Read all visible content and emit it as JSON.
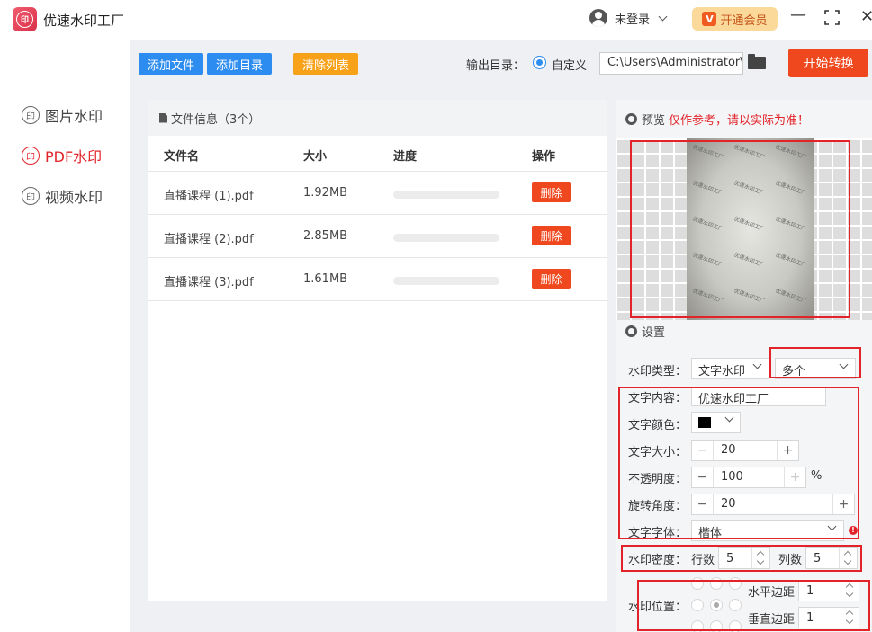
{
  "app": {
    "title": "优速水印工厂",
    "logo_glyph": "印"
  },
  "user": {
    "login_label": "未登录",
    "vip_label": "开通会员",
    "vip_glyph": "V"
  },
  "window": {
    "minimize": "—",
    "close": "✕"
  },
  "nav": {
    "items": [
      {
        "label": "图片水印",
        "glyph": "印",
        "active": false
      },
      {
        "label": "PDF水印",
        "glyph": "印",
        "active": true
      },
      {
        "label": "视频水印",
        "glyph": "印",
        "active": false
      }
    ]
  },
  "toolbar": {
    "add_file": "添加文件",
    "add_dir": "添加目录",
    "clear_list": "清除列表",
    "output_label": "输出目录：",
    "output_mode": "自定义",
    "output_path": "C:\\Users\\Administrator\\",
    "start": "开始转换"
  },
  "files": {
    "header": "文件信息（3个）",
    "columns": {
      "name": "文件名",
      "size": "大小",
      "progress": "进度",
      "action": "操作"
    },
    "rows": [
      {
        "name": "直播课程 (1).pdf",
        "size": "1.92MB",
        "progress": 0,
        "action": "删除"
      },
      {
        "name": "直播课程 (2).pdf",
        "size": "2.85MB",
        "progress": 0,
        "action": "删除"
      },
      {
        "name": "直播课程 (3).pdf",
        "size": "1.61MB",
        "progress": 0,
        "action": "删除"
      }
    ]
  },
  "preview": {
    "label": "预览",
    "warning": "仅作参考，请以实际为准！",
    "watermark_text": "优速水印工厂"
  },
  "settings": {
    "label": "设置",
    "type_label": "水印类型：",
    "type_value": "文字水印",
    "multi_value": "多个",
    "content_label": "文字内容：",
    "content_value": "优速水印工厂",
    "color_label": "文字颜色：",
    "color_value": "#000000",
    "size_label": "文字大小：",
    "size_value": "20",
    "opacity_label": "不透明度：",
    "opacity_value": "100",
    "opacity_unit": "%",
    "rotate_label": "旋转角度：",
    "rotate_value": "20",
    "font_label": "文字字体：",
    "font_value": "楷体",
    "density_label": "水印密度：",
    "rows_label": "行数",
    "rows_value": "5",
    "cols_label": "列数",
    "cols_value": "5",
    "position_label": "水印位置：",
    "h_margin_label": "水平边距",
    "h_margin_value": "1",
    "v_margin_label": "垂直边距",
    "v_margin_value": "1"
  },
  "colors": {
    "accent_blue": "#2d8cf0",
    "danger": "#f0481e",
    "highlight_red": "#e2242a",
    "orange": "#f7a219"
  }
}
